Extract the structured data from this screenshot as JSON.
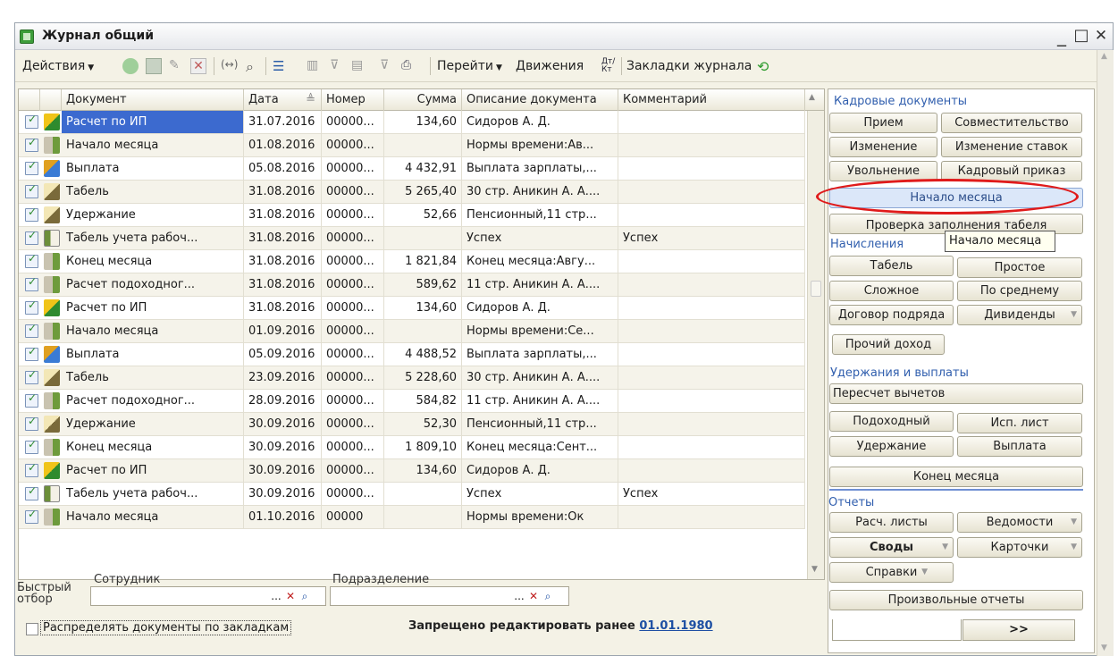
{
  "window": {
    "title": "Журнал общий",
    "minimize": "_",
    "maximize": "□",
    "close": "✕"
  },
  "toolbar": {
    "actions_label": "Действия",
    "goto_label": "Перейти",
    "movements_label": "Движения",
    "bookmarks_label": "Закладки журнала",
    "kt_label": "Дт/Кт"
  },
  "grid": {
    "columns": [
      "Документ",
      "Дата",
      "Номер",
      "Сумма",
      "Описание документа",
      "Комментарий"
    ],
    "rows": [
      {
        "type": "ip",
        "doc": "Расчет по ИП",
        "date": "31.07.2016",
        "num": "00000...",
        "sum": "134,60",
        "desc": "Сидоров А. Д.",
        "comment": ""
      },
      {
        "type": "month",
        "doc": "Начало месяца",
        "date": "01.08.2016",
        "num": "00000...",
        "sum": "",
        "desc": "Нормы времени:Ав...",
        "comment": ""
      },
      {
        "type": "pay",
        "doc": "Выплата",
        "date": "05.08.2016",
        "num": "00000...",
        "sum": "4 432,91",
        "desc": "Выплата зарплаты,...",
        "comment": ""
      },
      {
        "type": "tabel",
        "doc": "Табель",
        "date": "31.08.2016",
        "num": "00000...",
        "sum": "5 265,40",
        "desc": "30 стр. Аникин А. А....",
        "comment": ""
      },
      {
        "type": "tabel",
        "doc": "Удержание",
        "date": "31.08.2016",
        "num": "00000...",
        "sum": "52,66",
        "desc": "Пенсионный,11 стр...",
        "comment": ""
      },
      {
        "type": "work",
        "doc": "Табель учета рабоч...",
        "date": "31.08.2016",
        "num": "00000...",
        "sum": "",
        "desc": "Успех",
        "comment": "Успех"
      },
      {
        "type": "month",
        "doc": "Конец месяца",
        "date": "31.08.2016",
        "num": "00000...",
        "sum": "1 821,84",
        "desc": "Конец месяца:Авгу...",
        "comment": ""
      },
      {
        "type": "month",
        "doc": "Расчет подоходног...",
        "date": "31.08.2016",
        "num": "00000...",
        "sum": "589,62",
        "desc": "11 стр. Аникин А. А....",
        "comment": ""
      },
      {
        "type": "ip",
        "doc": "Расчет по ИП",
        "date": "31.08.2016",
        "num": "00000...",
        "sum": "134,60",
        "desc": "Сидоров А. Д.",
        "comment": ""
      },
      {
        "type": "month",
        "doc": "Начало месяца",
        "date": "01.09.2016",
        "num": "00000...",
        "sum": "",
        "desc": "Нормы времени:Се...",
        "comment": ""
      },
      {
        "type": "pay",
        "doc": "Выплата",
        "date": "05.09.2016",
        "num": "00000...",
        "sum": "4 488,52",
        "desc": "Выплата зарплаты,...",
        "comment": ""
      },
      {
        "type": "tabel",
        "doc": "Табель",
        "date": "23.09.2016",
        "num": "00000...",
        "sum": "5 228,60",
        "desc": "30 стр. Аникин А. А....",
        "comment": ""
      },
      {
        "type": "month",
        "doc": "Расчет подоходног...",
        "date": "28.09.2016",
        "num": "00000...",
        "sum": "584,82",
        "desc": "11 стр. Аникин А. А....",
        "comment": ""
      },
      {
        "type": "tabel",
        "doc": "Удержание",
        "date": "30.09.2016",
        "num": "00000...",
        "sum": "52,30",
        "desc": "Пенсионный,11 стр...",
        "comment": ""
      },
      {
        "type": "month",
        "doc": "Конец месяца",
        "date": "30.09.2016",
        "num": "00000...",
        "sum": "1 809,10",
        "desc": "Конец месяца:Сент...",
        "comment": ""
      },
      {
        "type": "ip",
        "doc": "Расчет по ИП",
        "date": "30.09.2016",
        "num": "00000...",
        "sum": "134,60",
        "desc": "Сидоров А. Д.",
        "comment": ""
      },
      {
        "type": "work",
        "doc": "Табель учета рабоч...",
        "date": "30.09.2016",
        "num": "00000...",
        "sum": "",
        "desc": "Успех",
        "comment": "Успех"
      },
      {
        "type": "month",
        "doc": "Начало месяца",
        "date": "01.10.2016",
        "num": "00000",
        "sum": "",
        "desc": "Нормы времени:Ок",
        "comment": ""
      }
    ]
  },
  "quick_filter": {
    "label_line1": "Быстрый",
    "label_line2": "отбор",
    "employee_label": "Сотрудник",
    "department_label": "Подразделение",
    "dots": "...",
    "clear": "✕",
    "search": "⌕"
  },
  "bottom": {
    "distribute_label": "Распределять документы по закладкам",
    "forbidden_text": "Запрещено редактировать ранее",
    "forbidden_date": "01.01.1980"
  },
  "panel": {
    "hr_title": "Кадровые документы",
    "hr": {
      "hire": "Прием",
      "combining": "Совместительство",
      "change": "Изменение",
      "change_rates": "Изменение ставок",
      "dismissal": "Увольнение",
      "hr_order": "Кадровый приказ",
      "month_start": "Начало месяца",
      "tabel_check": "Проверка заполнения табеля"
    },
    "tooltip": "Начало месяца",
    "accr_title": "Начисления",
    "accr": {
      "tabel": "Табель",
      "simple": "Простое",
      "complex": "Сложное",
      "average": "По среднему",
      "contract": "Договор подряда",
      "dividends": "Дивиденды",
      "other_income": "Прочий доход"
    },
    "ded_title": "Удержания и выплаты",
    "ded": {
      "recalc": "Пересчет вычетов",
      "income_tax": "Подоходный",
      "writ": "Исп. лист",
      "deduction": "Удержание",
      "payment": "Выплата",
      "month_end": "Конец месяца"
    },
    "rep_title": "Отчеты",
    "rep": {
      "payslips": "Расч. листы",
      "statements": "Ведомости",
      "summaries": "Своды",
      "cards": "Карточки",
      "references": "Справки",
      "custom": "Произвольные отчеты"
    },
    "tab_next": ">>"
  },
  "colors": {
    "accent": "#315fae",
    "selection": "#3c6acf",
    "highlight_ellipse": "#e01b1b"
  }
}
